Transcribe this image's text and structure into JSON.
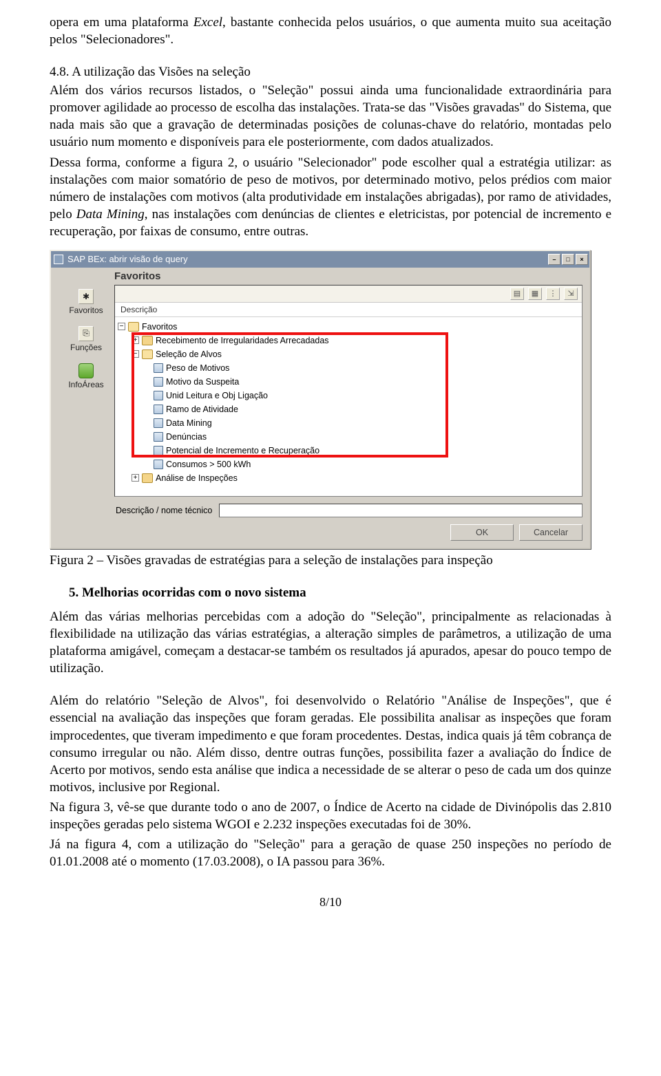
{
  "body": {
    "p1a": "opera em uma plataforma ",
    "p1i": "Excel",
    "p1b": ", bastante conhecida pelos usuários, o que aumenta muito sua aceitação pelos \"Selecionadores\".",
    "section48_num": "4.8. A utilização das ",
    "section48_vis": "Visões",
    "section48_rest": " na seleção",
    "p2": "Além dos vários recursos listados, o \"Seleção\" possui ainda uma funcionalidade extraordinária para promover agilidade ao processo de escolha das instalações. Trata-se das \"Visões gravadas\" do Sistema, que nada mais são que a gravação de determinadas posições de colunas-chave do relatório, montadas pelo usuário num momento e disponíveis para ele posteriormente, com dados atualizados.",
    "p3a": "Dessa forma, conforme a figura 2, o usuário \"Selecionador\" pode escolher qual a estratégia utilizar: as instalações com maior somatório de peso de motivos, por determinado motivo, pelos prédios com maior número de instalações com motivos (alta produtividade em instalações abrigadas), por ramo de atividades, pelo ",
    "p3i": "Data Mining",
    "p3b": ", nas instalações com denúncias de clientes e eletricistas, por potencial de incremento e recuperação, por faixas de consumo, entre outras.",
    "figure_caption": "Figura 2 – Visões gravadas de estratégias para a seleção de instalações para inspeção",
    "section5": "5.   Melhorias ocorridas com o novo sistema",
    "p4": "Além das várias melhorias percebidas com a adoção do \"Seleção\", principalmente as relacionadas à flexibilidade na utilização das várias estratégias, a alteração simples de parâmetros, a utilização de uma plataforma amigável, começam a destacar-se também os resultados já apurados, apesar do pouco tempo de utilização.",
    "p5": "Além do relatório \"Seleção de Alvos\", foi desenvolvido o Relatório \"Análise de Inspeções\", que é essencial na avaliação das inspeções que foram geradas. Ele possibilita analisar as inspeções que foram improcedentes, que tiveram impedimento e que foram procedentes. Destas, indica quais já têm cobrança de consumo irregular ou não. Além disso, dentre outras funções, possibilita fazer a avaliação do Índice de Acerto por motivos, sendo esta análise que indica a necessidade de se alterar o peso de cada um dos quinze motivos, inclusive por Regional.",
    "p6": "Na figura 3, vê-se que durante todo o ano de 2007, o Índice de Acerto na cidade de Divinópolis das 2.810 inspeções geradas pelo sistema WGOI e 2.232 inspeções executadas foi de 30%.",
    "p7": "Já na figura 4, com a utilização do \"Seleção\" para a geração de quase 250 inspeções no período de 01.01.2008 até o momento (17.03.2008), o IA passou para 36%.",
    "pagenum": "8/10"
  },
  "sap": {
    "title": "SAP BEx: abrir visão de query",
    "win_min": "–",
    "win_max": "□",
    "win_close": "×",
    "fav_header": "Favoritos",
    "side": {
      "favoritos": "Favoritos",
      "funcoes": "Funções",
      "infoareas": "InfoÁreas"
    },
    "tools": {
      "t1": "▤",
      "t2": "▦",
      "t3": "⋮",
      "t4": "⇲"
    },
    "col_label": "Descrição",
    "tree": {
      "root": "Favoritos",
      "recebimento": "Recebimento de Irregularidades Arrecadadas",
      "selecao": "Seleção de Alvos",
      "items": [
        "Peso de Motivos",
        "Motivo da Suspeita",
        "Unid Leitura e Obj Ligação",
        "Ramo de Atividade",
        "Data Mining",
        "Denúncias",
        "Potencial de Incremento e Recuperação",
        "Consumos > 500 kWh"
      ],
      "analise": "Análise de Inspeções"
    },
    "desc_label": "Descrição / nome técnico",
    "btn_ok": "OK",
    "btn_cancel": "Cancelar"
  }
}
